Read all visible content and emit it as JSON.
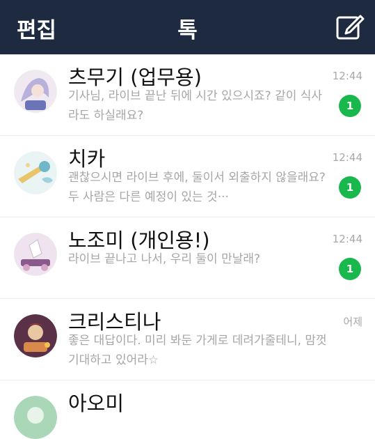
{
  "header": {
    "edit_label": "편집",
    "title": "톡"
  },
  "chats": [
    {
      "name": "츠무기 (업무용)",
      "message": "기사님, 라이브 끝난 뒤에 시간 있으시죠? 같이 식사라도 하실래요?",
      "time": "12:44",
      "unread": "1",
      "avatar_colors": [
        "#c7c3e6",
        "#f3e6ef"
      ]
    },
    {
      "name": "치카",
      "message": "괜찮으시면 라이브 후에, 둘이서 외출하지 않을래요? 두 사람은 다른 예정이 있는 것···",
      "time": "12:44",
      "unread": "1",
      "avatar_colors": [
        "#cfe6ec",
        "#f4e3b0"
      ]
    },
    {
      "name": "노조미 (개인용!)",
      "message": "라이브 끝나고 나서, 우리 둘이 만날래?",
      "time": "12:44",
      "unread": "1",
      "avatar_colors": [
        "#e3cfe6",
        "#8a5a8c"
      ]
    },
    {
      "name": "크리스티나",
      "message": "좋은 대답이다. 미리 봐둔 가게로 데려가줄테니, 맘껏 기대하고 있어라☆",
      "time": "어제",
      "unread": "",
      "avatar_colors": [
        "#6a3c55",
        "#d98a4a"
      ]
    },
    {
      "name": "아오미",
      "message": "",
      "time": "",
      "unread": "",
      "avatar_colors": [
        "#a9d7b8",
        "#e8f4ea"
      ]
    }
  ],
  "colors": {
    "header_bg": "#1e2a40",
    "badge": "#19b84c",
    "muted_text": "#a6a6a6"
  },
  "icons": {
    "compose": "compose-icon"
  }
}
